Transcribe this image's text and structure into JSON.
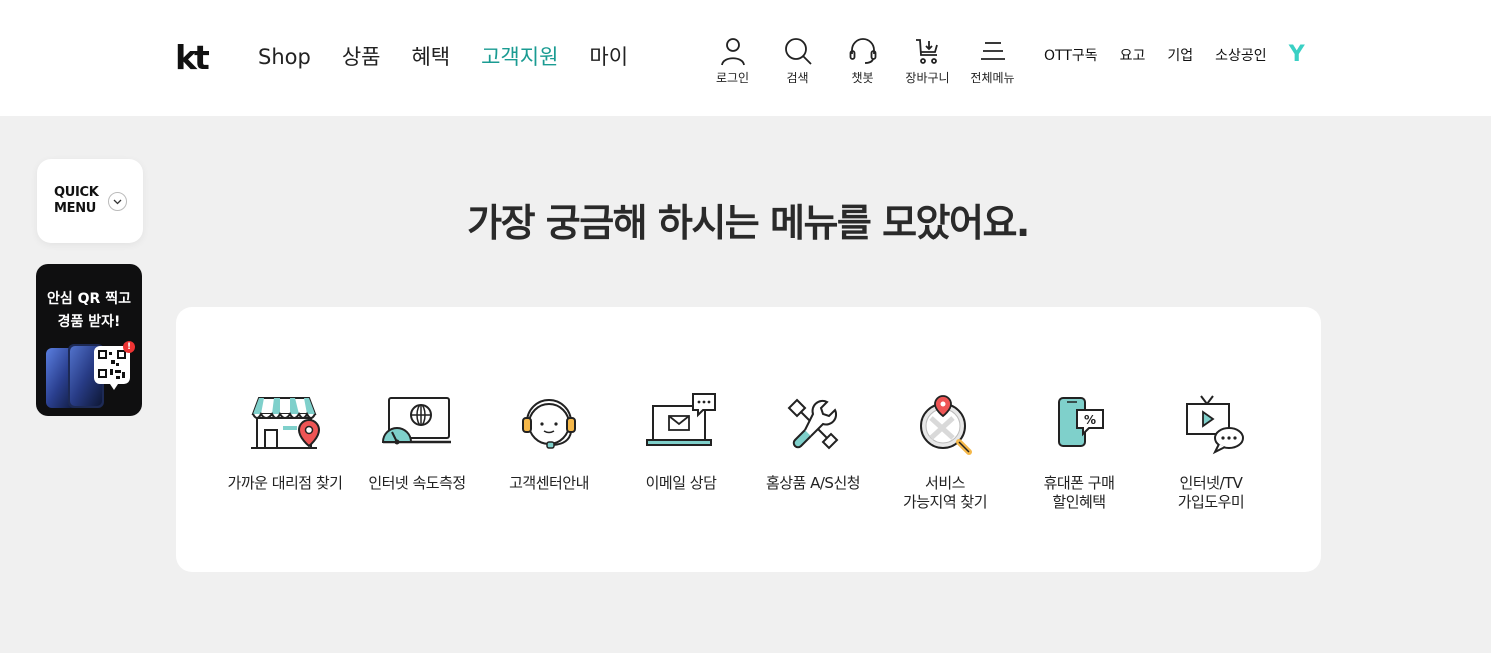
{
  "header": {
    "logo": "kt",
    "nav": [
      {
        "label": "Shop",
        "active": false
      },
      {
        "label": "상품",
        "active": false
      },
      {
        "label": "혜택",
        "active": false
      },
      {
        "label": "고객지원",
        "active": true
      },
      {
        "label": "마이",
        "active": false
      }
    ],
    "util": {
      "login": "로그인",
      "search": "검색",
      "chatbot": "챗봇",
      "cart": "장바구니",
      "all_menu": "전체메뉴"
    },
    "biz_links": {
      "ott": "OTT구독",
      "yogo": "요고",
      "enterprise": "기업",
      "small_biz": "소상공인"
    },
    "y_logo": "Y",
    "accent_color": "#1a9b92"
  },
  "quick_menu": {
    "line1": "QUICK",
    "line2": "MENU",
    "chevron": "⌄"
  },
  "qr_banner": {
    "line1": "안심 QR 찍고",
    "line2": "경품 받자!",
    "badge": "!"
  },
  "main": {
    "headline": "가장 궁금해 하시는 메뉴를 모았어요.",
    "services": [
      {
        "icon": "store-location-icon",
        "line1": "가까운 대리점 찾기",
        "line2": ""
      },
      {
        "icon": "speed-test-icon",
        "line1": "인터넷 속도측정",
        "line2": ""
      },
      {
        "icon": "headset-agent-icon",
        "line1": "고객센터안내",
        "line2": ""
      },
      {
        "icon": "email-laptop-icon",
        "line1": "이메일 상담",
        "line2": ""
      },
      {
        "icon": "tools-icon",
        "line1": "홈상품 A/S신청",
        "line2": ""
      },
      {
        "icon": "coverage-map-icon",
        "line1": "서비스",
        "line2": "가능지역 찾기"
      },
      {
        "icon": "phone-discount-icon",
        "line1": "휴대폰 구매",
        "line2": "할인혜택"
      },
      {
        "icon": "tv-chat-icon",
        "line1": "인터넷/TV",
        "line2": "가입도우미"
      }
    ]
  }
}
